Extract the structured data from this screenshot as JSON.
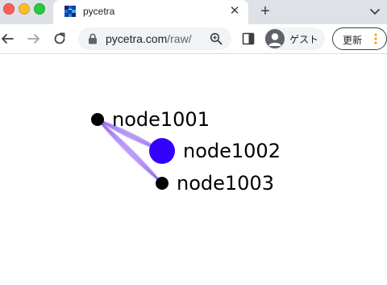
{
  "browser": {
    "tab": {
      "title": "pycetra"
    },
    "omnibox": {
      "domain": "pycetra.com",
      "path": "/raw/"
    },
    "profile": {
      "label": "ゲスト"
    },
    "update": {
      "label": "更新"
    }
  },
  "graph": {
    "nodes": [
      {
        "id": "node1001",
        "label": "node1001",
        "color": "#000000",
        "size": "small"
      },
      {
        "id": "node1002",
        "label": "node1002",
        "color": "#3300ff",
        "size": "large"
      },
      {
        "id": "node1003",
        "label": "node1003",
        "color": "#000000",
        "size": "small"
      }
    ],
    "edges": [
      {
        "source": "node1001",
        "target": "node1002",
        "color": "#8a5cf0"
      },
      {
        "source": "node1001",
        "target": "node1003",
        "color": "#8a5cf0"
      }
    ]
  }
}
